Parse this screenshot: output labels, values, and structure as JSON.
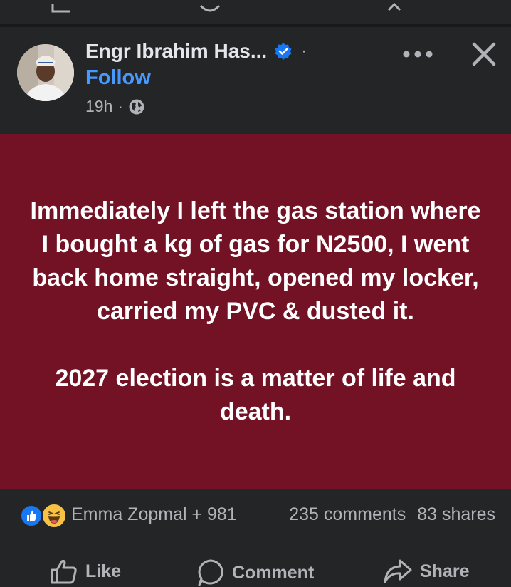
{
  "post": {
    "author": "Engr Ibrahim Has...",
    "follow_label": "Follow",
    "separator": "·",
    "time": "19h",
    "time_separator": "·",
    "privacy_icon": "globe-icon",
    "body_text": "Immediately I left the gas station where I bought a kg of gas for N2500, I went back home straight, opened my locker, carried my PVC & dusted it.\n\n2027 election is a matter of life and death.",
    "body_background": "#731224"
  },
  "reactions": {
    "icons": [
      "like-reaction-icon",
      "haha-reaction-icon"
    ],
    "names": "Emma Zopmal + 981",
    "comments": "235 comments",
    "shares": "83 shares"
  },
  "actions": {
    "like": "Like",
    "comment": "Comment",
    "share": "Share"
  },
  "colors": {
    "background": "#242526",
    "accent": "#4599ff",
    "verified": "#1877f2",
    "secondary_text": "#b0b3b8"
  }
}
